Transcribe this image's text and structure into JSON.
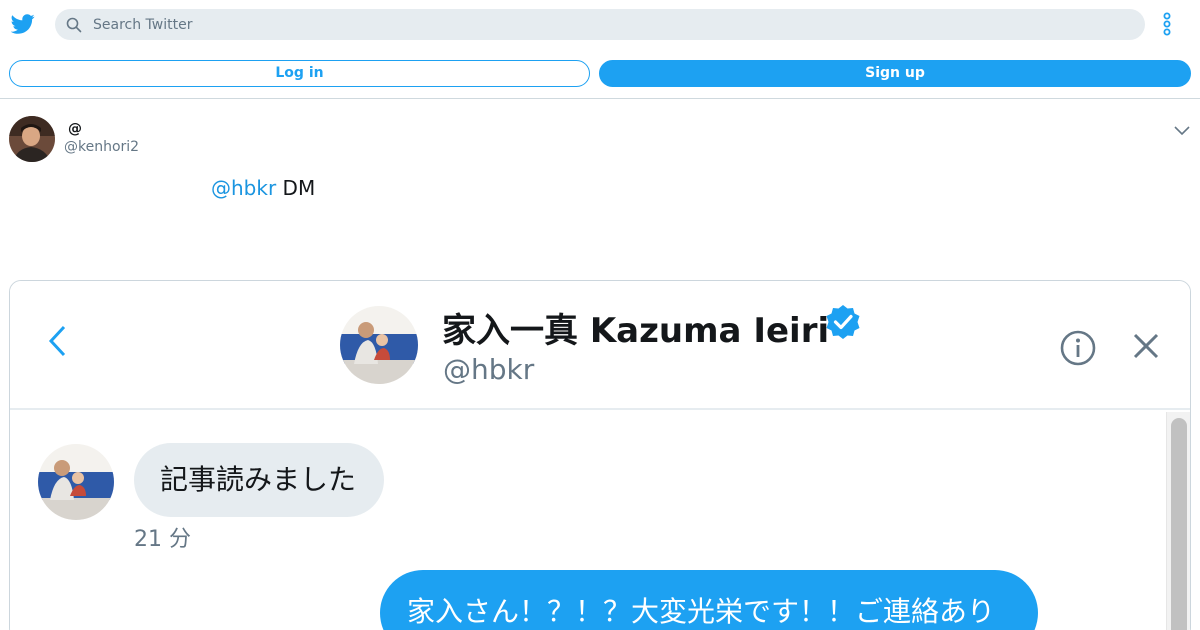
{
  "header": {
    "logo_icon": "twitter-bird-icon",
    "search": {
      "placeholder": "Search Twitter",
      "value": "",
      "icon": "search-icon"
    },
    "more_icon": "vertical-ellipsis-icon",
    "login_label": "Log in",
    "signup_label": "Sign up",
    "accent_color": "#1da1f2"
  },
  "tweet": {
    "display_name": "@",
    "handle": "@kenhori2",
    "text_mention": "@hbkr",
    "text_rest": " DM",
    "caret_icon": "chevron-down-icon"
  },
  "media": {
    "dm_header": {
      "name": "家入一真 Kazuma Ieiri",
      "handle": "@hbkr",
      "verified_icon": "verified-badge-icon",
      "back_icon": "chevron-left-icon",
      "info_icon": "info-icon",
      "close_icon": "close-icon"
    },
    "messages": [
      {
        "direction": "incoming",
        "text": "記事読みました",
        "time": "21 分"
      },
      {
        "direction": "outgoing",
        "text": "家入さん！？！？大変光栄です！！ご連絡あり"
      }
    ]
  }
}
